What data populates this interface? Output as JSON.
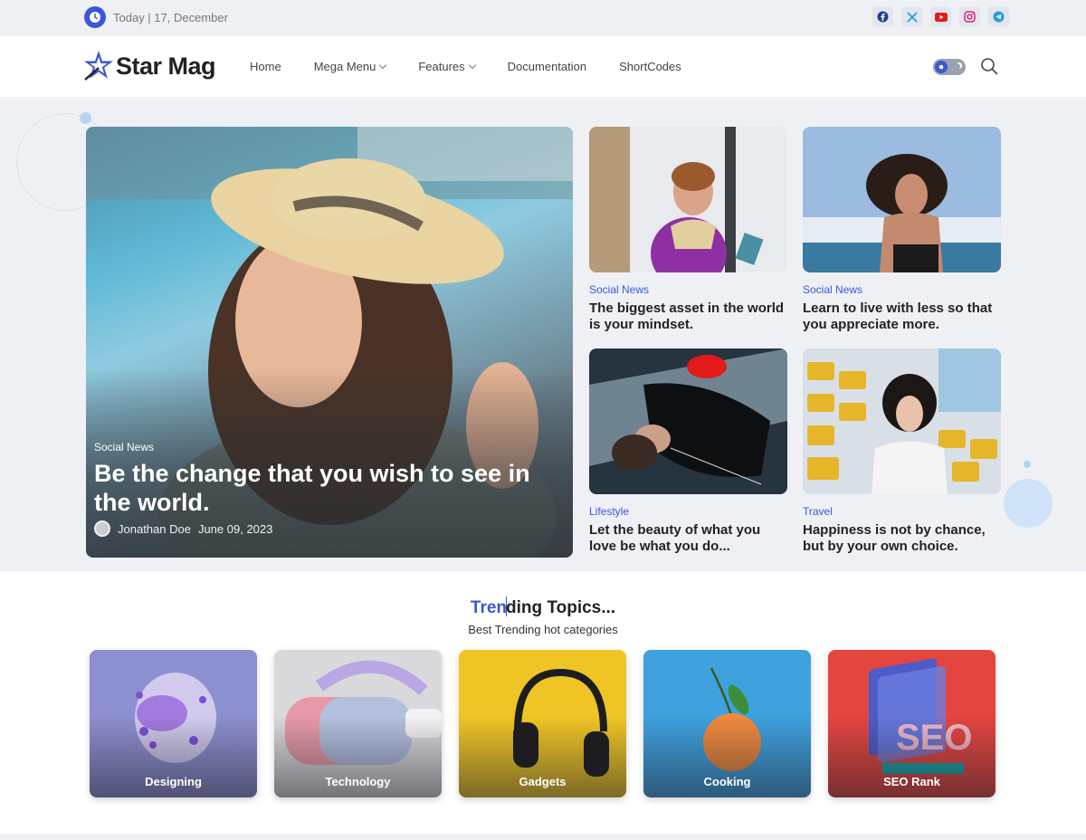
{
  "topbar": {
    "date": "Today | 17, December",
    "social_icons": [
      "facebook-icon",
      "x-icon",
      "youtube-icon",
      "instagram-icon",
      "telegram-icon"
    ]
  },
  "header": {
    "logo_text": "Star Mag",
    "nav": [
      {
        "label": "Home",
        "dropdown": false
      },
      {
        "label": "Mega Menu",
        "dropdown": true
      },
      {
        "label": "Features",
        "dropdown": true
      },
      {
        "label": "Documentation",
        "dropdown": false
      },
      {
        "label": "ShortCodes",
        "dropdown": false
      }
    ]
  },
  "feature": {
    "category": "Social News",
    "title": "Be the change that you wish to see in the world.",
    "author": "Jonathan Doe",
    "date": "June 09, 2023"
  },
  "cards": [
    {
      "category": "Social News",
      "title": "The biggest asset in the world is your mindset."
    },
    {
      "category": "Social News",
      "title": "Learn to live with less so that you appreciate more."
    },
    {
      "category": "Lifestyle",
      "title": "Let the beauty of what you love be what you do..."
    },
    {
      "category": "Travel",
      "title": "Happiness is not by chance, but by your own choice."
    }
  ],
  "trending": {
    "title_highlight": "Tren",
    "title_highlight2": "d",
    "title_rest": "ing Topics...",
    "subtitle": "Best Trending hot categories",
    "topics": [
      "Designing",
      "Technology",
      "Gadgets",
      "Cooking",
      "SEO Rank"
    ]
  },
  "colors": {
    "accent": "#3b57d9",
    "page_bg": "#eef0f4"
  }
}
